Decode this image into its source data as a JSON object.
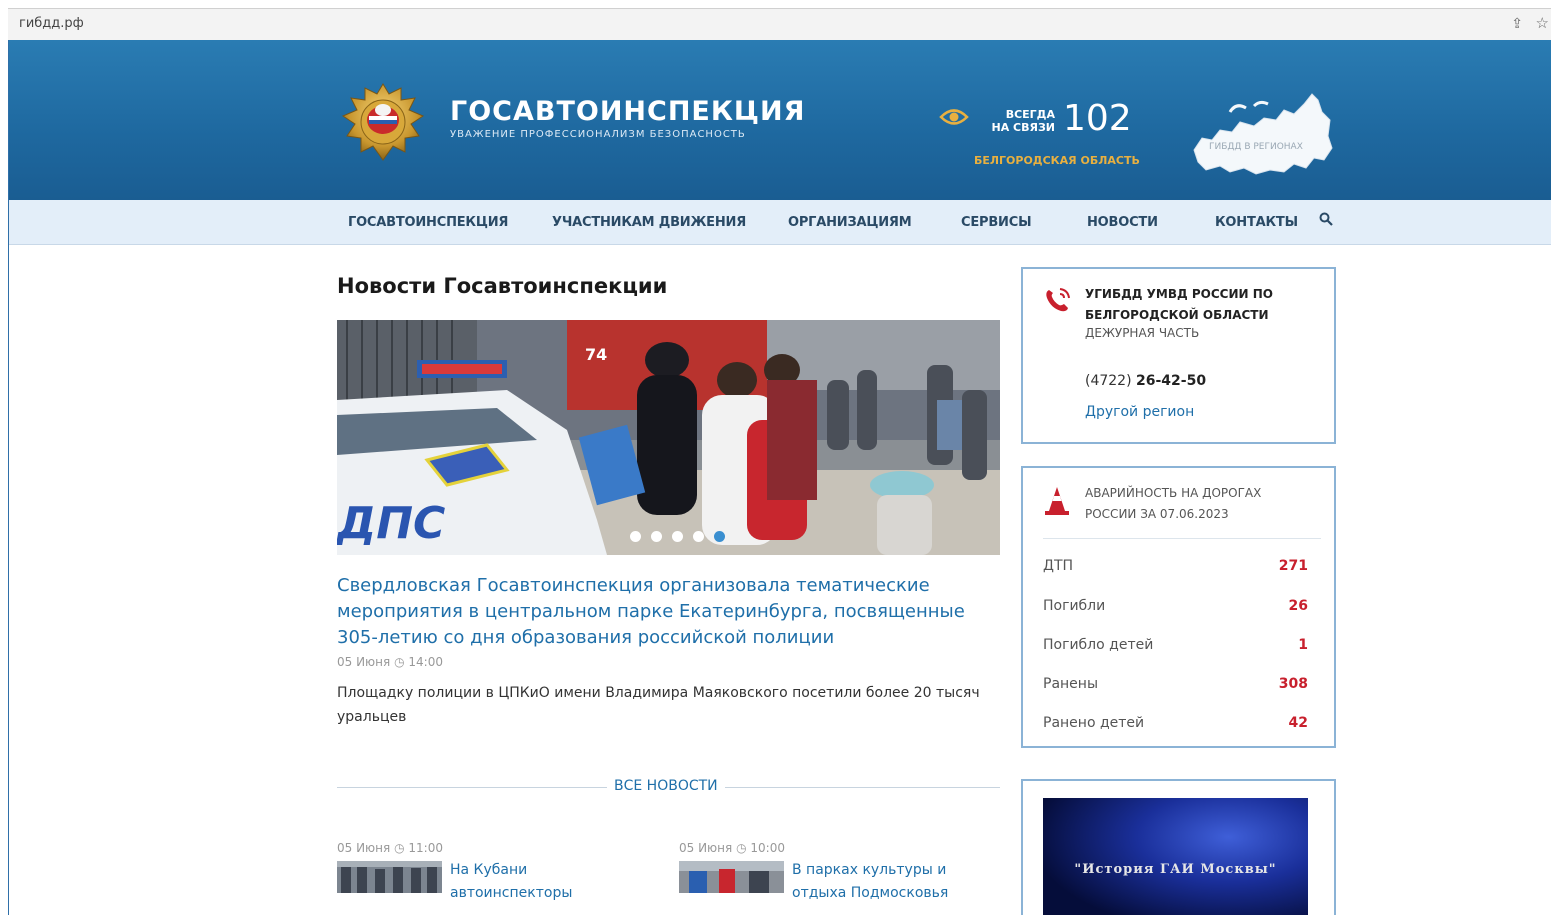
{
  "browser": {
    "url": "гибдд.рф"
  },
  "header": {
    "title": "ГОСАВТОИНСПЕКЦИЯ",
    "subtitle": "УВАЖЕНИЕ ПРОФЕССИОНАЛИЗМ БЕЗОПАСНОСТЬ",
    "always_line1": "ВСЕГДА",
    "always_line2": "НА СВЯЗИ",
    "phone": "102",
    "region": "БЕЛГОРОДСКАЯ ОБЛАСТЬ",
    "map_label": "ГИБДД В РЕГИОНАХ"
  },
  "nav": {
    "items": [
      "ГОСАВТОИНСПЕКЦИЯ",
      "УЧАСТНИКАМ ДВИЖЕНИЯ",
      "ОРГАНИЗАЦИЯМ",
      "СЕРВИСЫ",
      "НОВОСТИ",
      "КОНТАКТЫ"
    ]
  },
  "main": {
    "section_title": "Новости Госавтоинспекции",
    "hero_car_text": "ДПС",
    "hero_truck_number": "74",
    "headline": "Свердловская Госавтоинспекция организовала тематические мероприятия в центральном парке Екатеринбурга, посвященные 305-летию со дня образования российской полиции",
    "meta_date": "05 Июня",
    "meta_time": "14:00",
    "lead": "Площадку полиции в ЦПКиО имени Владимира Маяковского посетили более 20 тысяч уральцев",
    "all_news": "ВСЕ НОВОСТИ",
    "mini_news": [
      {
        "date": "05 Июня",
        "time": "11:00",
        "text": "На Кубани автоинспекторы"
      },
      {
        "date": "05 Июня",
        "time": "10:00",
        "text": "В парках культуры и отдыха Подмосковья"
      }
    ]
  },
  "sidebar": {
    "contact": {
      "title": "УГИБДД УМВД РОССИИ ПО БЕЛГОРОДСКОЙ ОБЛАСТИ",
      "subtitle": "ДЕЖУРНАЯ ЧАСТЬ",
      "phone_code": "(4722)",
      "phone_number": "26-42-50",
      "other_region": "Другой регион"
    },
    "accidents": {
      "title": "АВАРИЙНОСТЬ НА ДОРОГАХ РОССИИ ЗА 07.06.2023",
      "rows": [
        {
          "label": "ДТП",
          "value": "271"
        },
        {
          "label": "Погибли",
          "value": "26"
        },
        {
          "label": "Погибло детей",
          "value": "1"
        },
        {
          "label": "Ранены",
          "value": "308"
        },
        {
          "label": "Ранено детей",
          "value": "42"
        }
      ]
    },
    "video": {
      "title": "\"История ГАИ Москвы\""
    }
  },
  "colors": {
    "header_blue": "#1e689f",
    "link_blue": "#1f6fa9",
    "accent_red": "#c8202d",
    "region_gold": "#e8b040"
  }
}
